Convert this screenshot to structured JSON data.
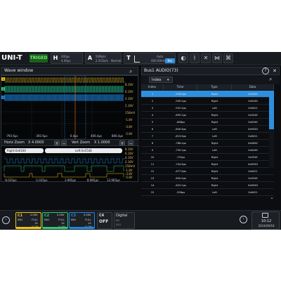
{
  "brand": {
    "logo": "UNI-T",
    "trigger_state": "TRIGED"
  },
  "topbar": {
    "horizontal": {
      "key": "H",
      "line1": "200µs",
      "line2": "4.00µs"
    },
    "acquire": {
      "key": "A",
      "line1": "50Mpts",
      "line2": "2.5GSa/s",
      "mode": "Normal"
    },
    "trigger": {
      "key": "T",
      "mode": "Auto",
      "level": "400.00mV",
      "slope_label": "Nor"
    },
    "icons": [
      "run-stop-icon",
      "single-icon",
      "auto-icon",
      "grid-icon",
      "zoom-icon"
    ]
  },
  "wave_window": {
    "title": "Wave window",
    "channels": [
      {
        "label": "1",
        "color": "#f1c40f"
      },
      {
        "label": "2",
        "color": "#2ecc71"
      },
      {
        "label": "3",
        "color": "#1e88e5"
      }
    ],
    "upper_right_scale": [
      "8.16V",
      "6.16V",
      "4.16V",
      "2.16V",
      "158mV",
      "-1.8V",
      "-3.8V",
      "-5.8V"
    ],
    "upper_time_axis": [
      "-793.6µs",
      "-393.6µs",
      "6.4µs",
      "406.4µs",
      "806.4µs"
    ],
    "horiz_zoom": {
      "label": "Horiz Zoom",
      "value": "X  4.0000"
    },
    "vert_zoom": {
      "label": "Vert Zoom",
      "value": "X  1.0000"
    },
    "decode_right": "Right:0x6160",
    "decode_left": "Left:0x554E",
    "lower_right_scale": [
      "8.16V",
      "6.16V",
      "4.16V",
      "2.16V",
      "158mV",
      "-1.8V",
      "-3.8V",
      "-5.8V"
    ],
    "lower_time_axis": [
      "-6.035µs",
      "-1.035µs",
      "3.965µs",
      "8.965µs",
      "13.965µs"
    ]
  },
  "bus_table": {
    "title": "Bus1 AUDIO(73)",
    "view": "Index",
    "headers": [
      "Index",
      "Time",
      "Type",
      "Data"
    ],
    "rows": [
      [
        "1",
        "-976.8µs",
        "Right",
        "0x554E"
      ],
      [
        "2",
        "-949.4µs",
        "Right",
        "0x6160"
      ],
      [
        "3",
        "-922.4µs",
        "Left",
        "0x6421"
      ],
      [
        "4",
        "-895.2µs",
        "Right",
        "0x554E"
      ],
      [
        "5",
        "-868µs",
        "Right",
        "0x6160"
      ],
      [
        "6",
        "-840.8µs",
        "Left",
        "0x692D"
      ],
      [
        "7",
        "-813.6µs",
        "Left",
        "0x6421"
      ],
      [
        "8",
        "-786.4µs",
        "Right",
        "0x6D62"
      ],
      [
        "9",
        "-759.2µs",
        "Left",
        "0x6160"
      ],
      [
        "10",
        "-732µs",
        "Right",
        "0x554E"
      ],
      [
        "11",
        "-704.8µs",
        "Right",
        "0x692D"
      ],
      [
        "12",
        "-677.6µs",
        "Right",
        "0x6421"
      ],
      [
        "13",
        "-650.4µs",
        "Right",
        "0x554E"
      ],
      [
        "14",
        "-623.2µs",
        "Right",
        "0x692D"
      ],
      [
        "15",
        "-596µs",
        "Left",
        "0x6421"
      ]
    ]
  },
  "channels_panel": [
    {
      "name": "C1",
      "color": "#f1c40f",
      "volts": "2.00V",
      "coupling": "FULL",
      "probe": "1X",
      "offset": "0.00V",
      "mode": "IMΩ"
    },
    {
      "name": "C2",
      "color": "#2ecc71",
      "volts": "2.00V",
      "coupling": "FULL",
      "probe": "1X",
      "offset": "0.00V",
      "mode": "IMΩ"
    },
    {
      "name": "C3",
      "color": "#1e88e5",
      "volts": "2.00V",
      "coupling": "FULL",
      "probe": "1X",
      "offset": "0.00V",
      "mode": "IMΩ"
    }
  ],
  "c4": {
    "name": "C4",
    "state": "OFF"
  },
  "digital": {
    "label": "Digital",
    "sub1": "D0",
    "sub2": "D15"
  },
  "clock": {
    "time": "10:12",
    "date": "2024/09/18"
  },
  "colors": {
    "accent": "#2f8fdd",
    "selected_row": "#2f8fdd"
  }
}
